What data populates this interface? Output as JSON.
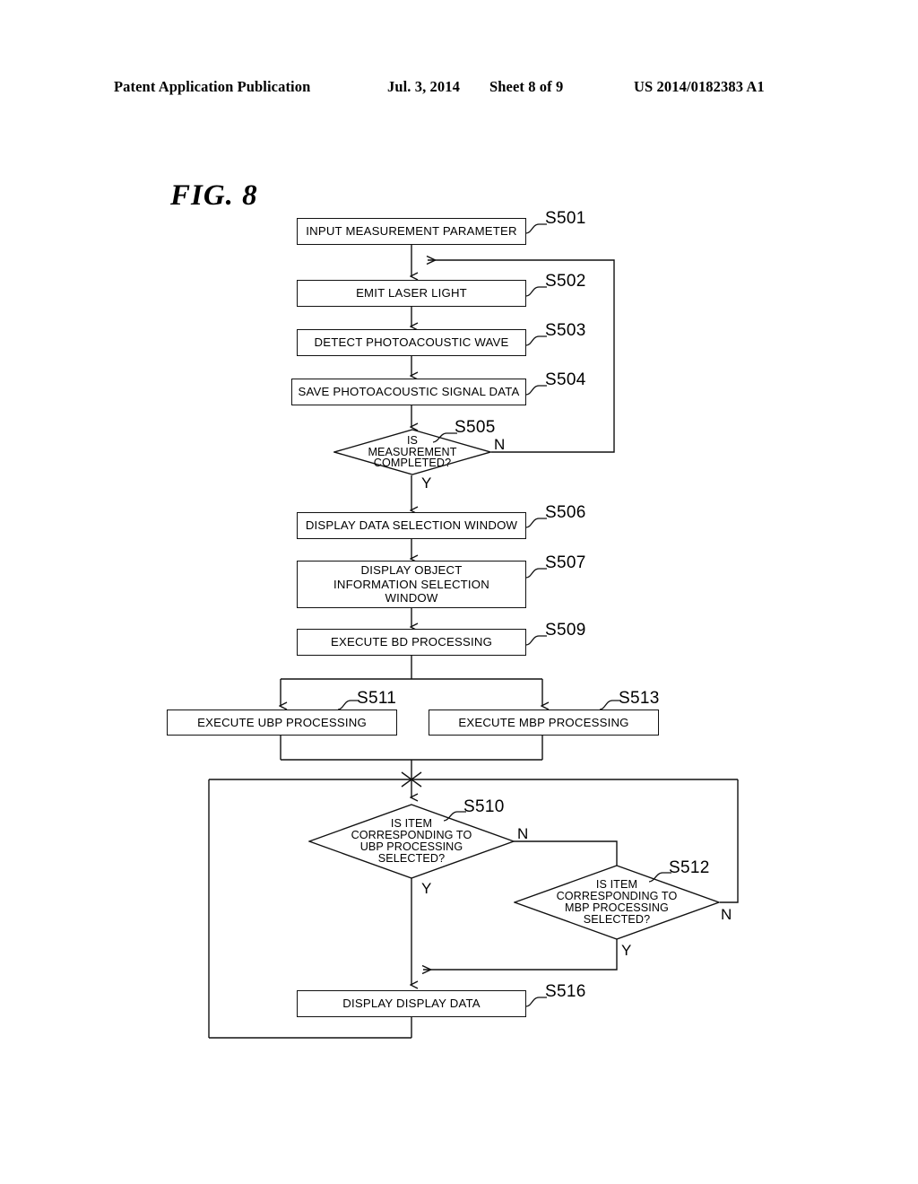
{
  "header": {
    "publication": "Patent Application Publication",
    "date": "Jul. 3, 2014",
    "sheet": "Sheet 8 of 9",
    "doc_number": "US 2014/0182383 A1"
  },
  "figure": {
    "title": "FIG. 8"
  },
  "flowchart": {
    "nodes": [
      {
        "id": "S501",
        "type": "process",
        "label": "INPUT MEASUREMENT PARAMETER",
        "tag": "S501"
      },
      {
        "id": "S502",
        "type": "process",
        "label": "EMIT LASER LIGHT",
        "tag": "S502"
      },
      {
        "id": "S503",
        "type": "process",
        "label": "DETECT PHOTOACOUSTIC WAVE",
        "tag": "S503"
      },
      {
        "id": "S504",
        "type": "process",
        "label": "SAVE PHOTOACOUSTIC SIGNAL DATA",
        "tag": "S504"
      },
      {
        "id": "S505",
        "type": "decision",
        "label": "IS\nMEASUREMENT\nCOMPLETED?",
        "tag": "S505"
      },
      {
        "id": "S506",
        "type": "process",
        "label": "DISPLAY DATA SELECTION WINDOW",
        "tag": "S506"
      },
      {
        "id": "S507",
        "type": "process",
        "label": "DISPLAY OBJECT\nINFORMATION SELECTION\nWINDOW",
        "tag": "S507"
      },
      {
        "id": "S509",
        "type": "process",
        "label": "EXECUTE BD PROCESSING",
        "tag": "S509"
      },
      {
        "id": "S511",
        "type": "process",
        "label": "EXECUTE UBP PROCESSING",
        "tag": "S511"
      },
      {
        "id": "S513",
        "type": "process",
        "label": "EXECUTE MBP PROCESSING",
        "tag": "S513"
      },
      {
        "id": "S510",
        "type": "decision",
        "label": "IS ITEM\nCORRESPONDING TO\nUBP PROCESSING\nSELECTED?",
        "tag": "S510"
      },
      {
        "id": "S512",
        "type": "decision",
        "label": "IS ITEM\nCORRESPONDING TO\nMBP PROCESSING\nSELECTED?",
        "tag": "S512"
      },
      {
        "id": "S516",
        "type": "process",
        "label": "DISPLAY DISPLAY DATA",
        "tag": "S516"
      }
    ],
    "branch_labels": {
      "s505_no": "N",
      "s505_yes": "Y",
      "s510_no": "N",
      "s510_yes": "Y",
      "s512_no": "N",
      "s512_yes": "Y"
    },
    "line_color": "#111111"
  }
}
